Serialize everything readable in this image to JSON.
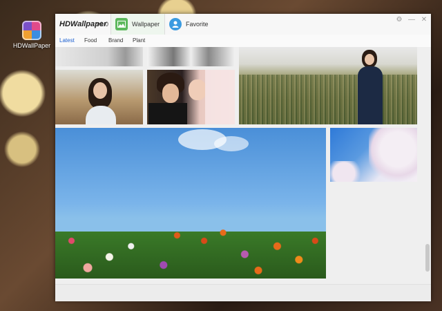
{
  "desktop": {
    "icon_label": "HDWallPaper",
    "icon_name": "hdwallpaper-app-icon"
  },
  "window": {
    "title": "HDWallpaper",
    "version": "v1.0",
    "tabs": [
      {
        "label": "Wallpaper",
        "icon": "image-icon"
      },
      {
        "label": "Favorite",
        "icon": "user-icon"
      }
    ],
    "controls": [
      "settings-icon",
      "minimize-icon",
      "close-icon"
    ]
  },
  "categories": [
    {
      "label": "Latest",
      "active": true
    },
    {
      "label": "Food",
      "active": false
    },
    {
      "label": "Brand",
      "active": false
    },
    {
      "label": "Plant",
      "active": false
    }
  ],
  "wallpapers": [
    {
      "name": "black-white-photo-1"
    },
    {
      "name": "black-white-photo-2"
    },
    {
      "name": "girl-portrait"
    },
    {
      "name": "couple-photo"
    },
    {
      "name": "girl-in-field"
    },
    {
      "name": "flowers-blue-sky"
    },
    {
      "name": "cherry-blossom-sky"
    }
  ],
  "colors": {
    "accent": "#1a5fd0",
    "wallpaper_tab": "#5cb85c",
    "favorite_tab": "#3b9be0"
  }
}
